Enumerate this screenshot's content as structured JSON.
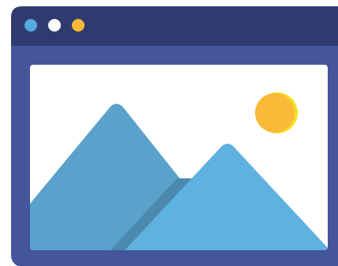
{
  "window": {
    "chrome_color": "#2f3b6e",
    "frame_color": "#44559a",
    "viewport_color": "#ffffff",
    "buttons": [
      {
        "name": "blue-dot",
        "color": "#55aadf"
      },
      {
        "name": "white-dot",
        "color": "#ffffff"
      },
      {
        "name": "yellow-dot",
        "color": "#fbb93a"
      }
    ]
  },
  "image": {
    "icon": "image-placeholder-icon",
    "sun_color": "#fbb93a",
    "sun_rim_color": "#f2e21f",
    "mountain_back_color": "#5aa1cb",
    "mountain_shadow_color": "#4b89ae",
    "mountain_front_color": "#5fb1e0"
  }
}
